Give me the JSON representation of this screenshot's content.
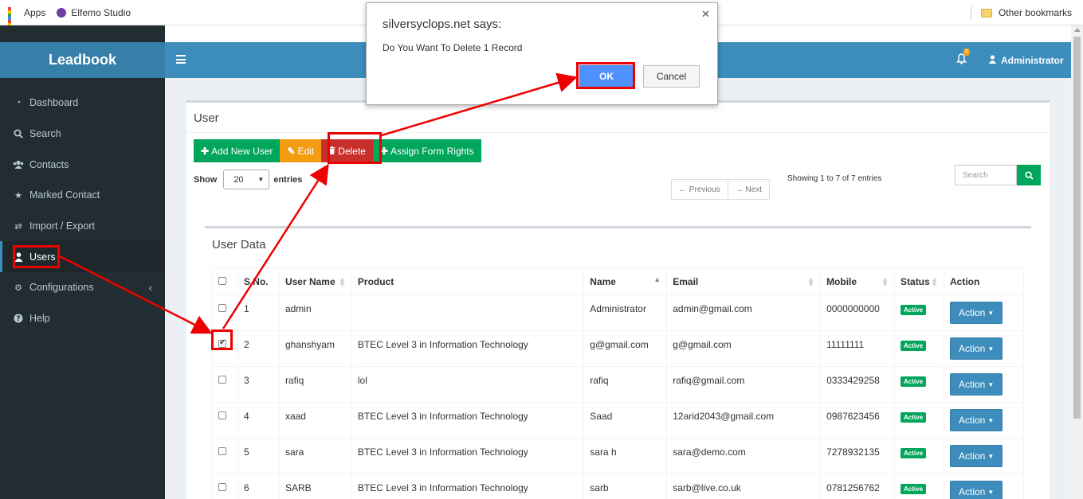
{
  "bookmarks": {
    "apps": "Apps",
    "elfemo": "Elfemo Studio",
    "other": "Other bookmarks"
  },
  "brand": "Leadbook",
  "sidebar": {
    "items": [
      {
        "label": "Dashboard",
        "icon": "dashboard-icon"
      },
      {
        "label": "Search",
        "icon": "search-icon"
      },
      {
        "label": "Contacts",
        "icon": "users-icon"
      },
      {
        "label": "Marked Contact",
        "icon": "star-icon"
      },
      {
        "label": "Import / Export",
        "icon": "exchange-icon"
      },
      {
        "label": "Users",
        "icon": "user-icon",
        "active": true
      },
      {
        "label": "Configurations",
        "icon": "cogs-icon"
      },
      {
        "label": "Help",
        "icon": "question-icon"
      }
    ]
  },
  "topnav": {
    "notification_count": "0",
    "user": "Administrator"
  },
  "page": {
    "title": "User",
    "buttons": {
      "add": "Add New User",
      "edit": "Edit",
      "delete": "Delete",
      "assign": "Assign Form Rights"
    },
    "show_label": "Show",
    "entries_value": "20",
    "entries_label": "entries",
    "prev": "← Previous",
    "next": "→ Next",
    "showing": "Showing 1 to 7 of 7 entries",
    "search_placeholder": "Search"
  },
  "table": {
    "title": "User Data",
    "headers": [
      "S.No.",
      "User Name",
      "Product",
      "Name",
      "Email",
      "Mobile",
      "Status",
      "Action"
    ],
    "rows": [
      {
        "sno": "1",
        "username": "admin",
        "product": "",
        "name": "Administrator",
        "email": "admin@gmail.com",
        "mobile": "0000000000",
        "status": "Active",
        "action": "Action",
        "checked": false
      },
      {
        "sno": "2",
        "username": "ghanshyam",
        "product": "BTEC Level 3 in Information Technology",
        "name": "g@gmail.com",
        "email": "g@gmail.com",
        "mobile": "11111111",
        "status": "Active",
        "action": "Action",
        "checked": true
      },
      {
        "sno": "3",
        "username": "rafiq",
        "product": "lol",
        "name": "rafiq",
        "email": "rafiq@gmail.com",
        "mobile": "0333429258",
        "status": "Active",
        "action": "Action",
        "checked": false
      },
      {
        "sno": "4",
        "username": "xaad",
        "product": "BTEC Level 3 in Information Technology",
        "name": "Saad",
        "email": "12arid2043@gmail.com",
        "mobile": "0987623456",
        "status": "Active",
        "action": "Action",
        "checked": false
      },
      {
        "sno": "5",
        "username": "sara",
        "product": "BTEC Level 3 in Information Technology",
        "name": "sara h",
        "email": "sara@demo.com",
        "mobile": "7278932135",
        "status": "Active",
        "action": "Action",
        "checked": false
      },
      {
        "sno": "6",
        "username": "SARB",
        "product": "BTEC Level 3 in Information Technology",
        "name": "sarb",
        "email": "sarb@live.co.uk",
        "mobile": "0781256762",
        "status": "Active",
        "action": "Action",
        "checked": false
      }
    ]
  },
  "dialog": {
    "title": "silversyclops.net says:",
    "message": "Do You Want To Delete 1 Record",
    "ok": "OK",
    "cancel": "Cancel"
  },
  "colors": {
    "sidebar": "#222d32",
    "brand": "#367fa9",
    "topnav": "#3c8dbc",
    "green": "#00a65a",
    "orange": "#f39c12",
    "red": "#c9302c",
    "annotation": "#e00000"
  }
}
